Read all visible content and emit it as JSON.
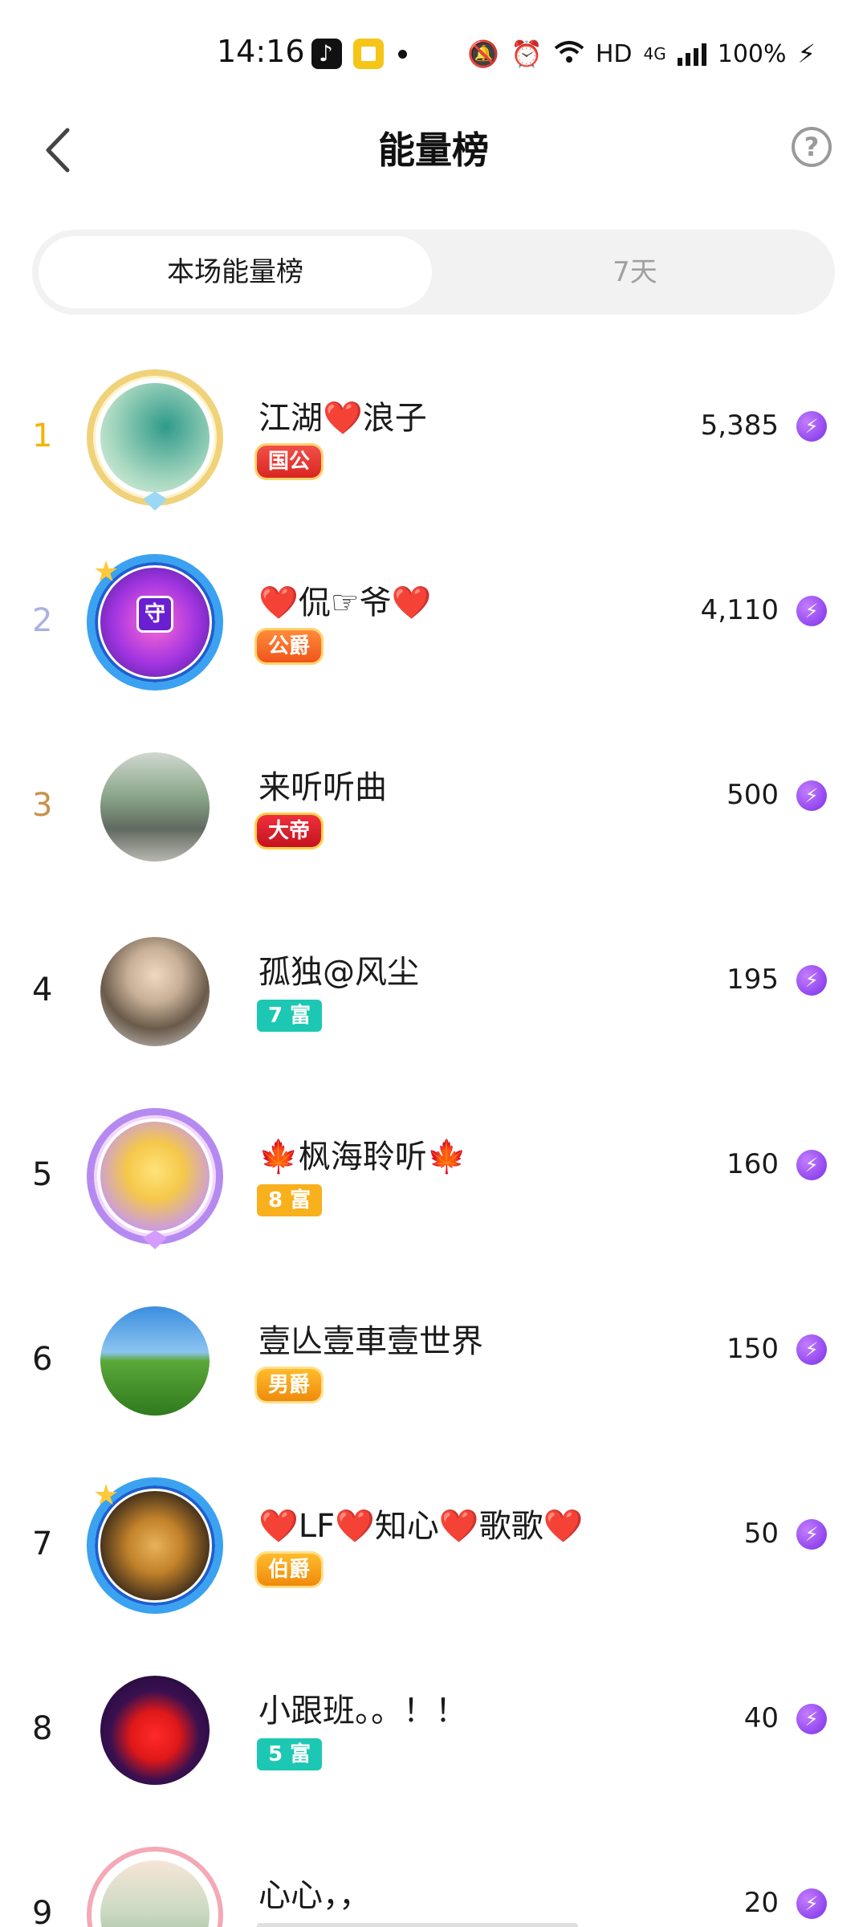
{
  "status_bar": {
    "time": "14:16",
    "network": "HD",
    "network_gen": "4G",
    "battery": "100%"
  },
  "header": {
    "title": "能量榜",
    "help_label": "?"
  },
  "tabs": [
    {
      "label": "本场能量榜",
      "active": true
    },
    {
      "label": "7天",
      "active": false
    }
  ],
  "rows": [
    {
      "rank": "1",
      "name": "江湖❤️浪子",
      "badge": "国公",
      "score": "5,385"
    },
    {
      "rank": "2",
      "name": "❤️侃☞爷❤️",
      "badge": "公爵",
      "score": "4,110"
    },
    {
      "rank": "3",
      "name": "来听听曲",
      "badge": "大帝",
      "score": "500"
    },
    {
      "rank": "4",
      "name": "孤独@风尘",
      "badge": "7 富",
      "score": "195"
    },
    {
      "rank": "5",
      "name": "🍁枫海聆听🍁",
      "badge": "8 富",
      "score": "160"
    },
    {
      "rank": "6",
      "name": "壹亾壹車壹世界",
      "badge": "男爵",
      "score": "150"
    },
    {
      "rank": "7",
      "name": "❤️LF❤️知心❤️歌歌❤️",
      "badge": "伯爵",
      "score": "50"
    },
    {
      "rank": "8",
      "name": "小跟班。。！！",
      "badge": "5 富",
      "score": "40"
    },
    {
      "rank": "9",
      "name": "心心，，",
      "badge": "",
      "score": "20"
    }
  ],
  "icons": {
    "energy": "lightning-energy-icon",
    "back": "chevron-left-icon",
    "help": "question-circle-icon"
  },
  "colors": {
    "rank1": "#f0b400",
    "rank2": "#aab0e0",
    "rank3": "#c8924a",
    "energy": "#8a3cf0"
  }
}
